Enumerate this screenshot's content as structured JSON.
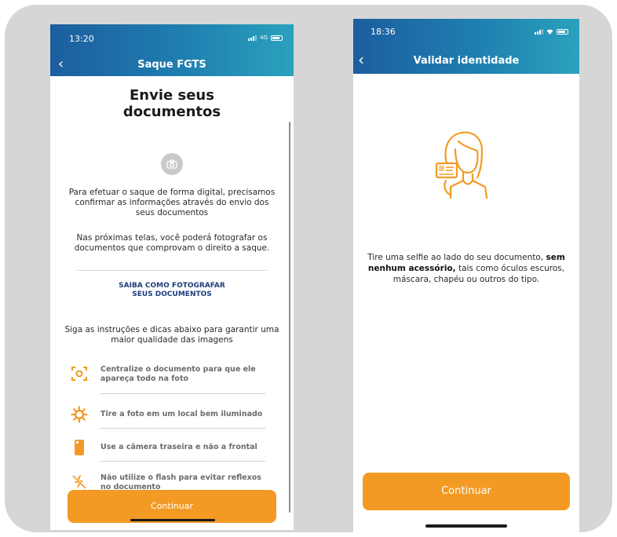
{
  "left_screen": {
    "status": {
      "time": "13:20",
      "network": "4G"
    },
    "header": {
      "title": "Saque FGTS",
      "back_icon": "chevron-left-icon"
    },
    "heading_line1": "Envie seus",
    "heading_line2": "documentos",
    "camera_icon": "camera-icon",
    "intro_text": "Para efetuar o saque de forma digital, precisamos confirmar as informações através do envio dos seus documentos",
    "next_screens_text": "Nas próximas telas, você poderá fotografar os documentos que comprovam o direito a saque.",
    "photo_guide_link_line1": "SAIBA COMO FOTOGRAFAR",
    "photo_guide_link_line2": "SEUS DOCUMENTOS",
    "instructions_text": "Siga as instruções e dicas abaixo para garantir uma maior qualidade das imagens",
    "tips": [
      {
        "icon": "focus-frame-icon",
        "text": "Centralize o documento para que ele apareça todo na foto"
      },
      {
        "icon": "sun-icon",
        "text": "Tire a foto em um local bem iluminado"
      },
      {
        "icon": "phone-icon",
        "text": "Use a câmera traseira e não a frontal"
      },
      {
        "icon": "flash-off-icon",
        "text": "Não utilize o flash para evitar reflexos no documento"
      }
    ],
    "continue_label": "Continuar"
  },
  "right_screen": {
    "status": {
      "time": "18:36"
    },
    "header": {
      "title": "Validar identidade",
      "back_icon": "chevron-left-icon"
    },
    "illustration": "woman-holding-document-icon",
    "message_part1": "Tire uma selfie ao lado do seu documento, ",
    "message_bold": "sem nenhum acessório,",
    "message_part2": " tais como óculos escuros, máscara, chapéu ou outros do tipo.",
    "continue_label": "Continuar"
  },
  "colors": {
    "header_gradient_start": "#1c5e9f",
    "header_gradient_end": "#2aa2bd",
    "accent_orange": "#f39a24",
    "link_navy": "#1c3d7a",
    "frame_gray": "#d6d6d7"
  }
}
